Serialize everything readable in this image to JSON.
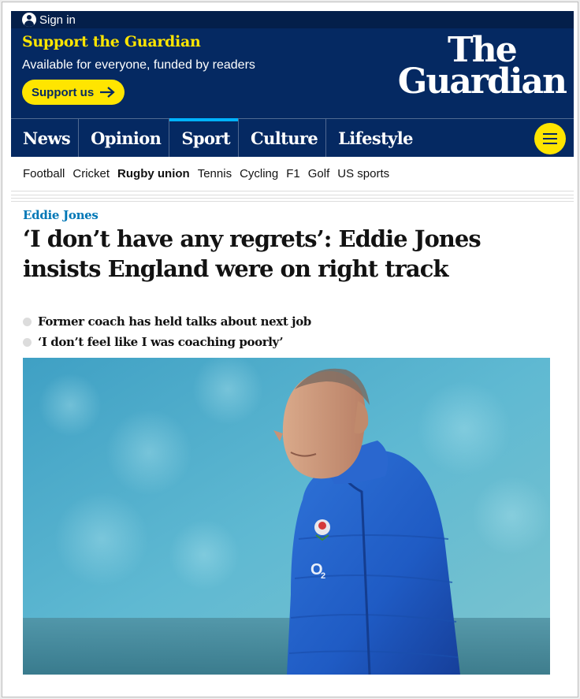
{
  "header": {
    "signin_label": "Sign in",
    "support_title": "Support the Guardian",
    "support_sub": "Available for everyone, funded by readers",
    "support_button": "Support us",
    "logo_line1": "The",
    "logo_line2": "Guardian"
  },
  "nav": {
    "items": [
      {
        "label": "News"
      },
      {
        "label": "Opinion"
      },
      {
        "label": "Sport",
        "active": true
      },
      {
        "label": "Culture"
      },
      {
        "label": "Lifestyle"
      }
    ]
  },
  "subnav": {
    "items": [
      {
        "label": "Football"
      },
      {
        "label": "Cricket"
      },
      {
        "label": "Rugby union",
        "active": true
      },
      {
        "label": "Tennis"
      },
      {
        "label": "Cycling"
      },
      {
        "label": "F1"
      },
      {
        "label": "Golf"
      },
      {
        "label": "US sports"
      }
    ]
  },
  "article": {
    "kicker": "Eddie Jones",
    "headline": "‘I don’t have any regrets’: Eddie Jones insists England were on right track",
    "standfirst": [
      "Former coach has held talks about next job",
      "‘I don’t feel like I was coaching poorly’"
    ]
  },
  "colors": {
    "brand_navy": "#052962",
    "support_yellow": "#ffe500",
    "sport_accent": "#00b2ff",
    "kicker_blue": "#0077b6"
  },
  "icons": [
    "user-icon",
    "arrow-right-icon",
    "menu-icon"
  ]
}
